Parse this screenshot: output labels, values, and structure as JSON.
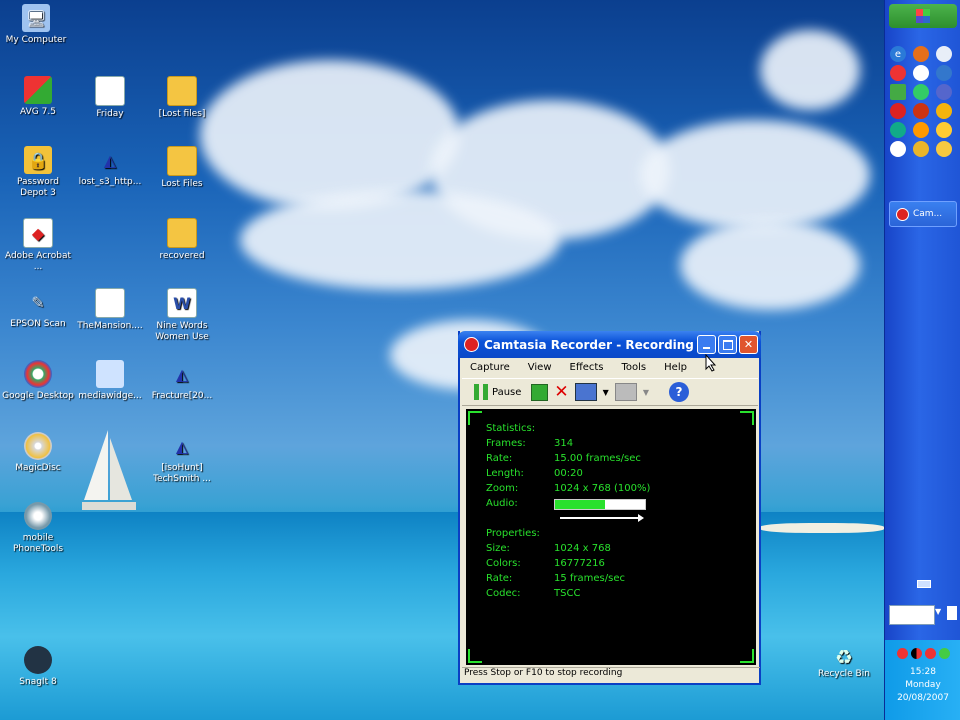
{
  "desktop_icons": [
    {
      "label": "My Computer",
      "glyph": "🖥"
    },
    {
      "label": "AVG 7.5",
      "glyph": "▦"
    },
    {
      "label": "Friday",
      "glyph": "▤"
    },
    {
      "label": "[Lost files]",
      "glyph": ""
    },
    {
      "label": "Password Depot 3",
      "glyph": "🔒"
    },
    {
      "label": "lost_s3_http...",
      "glyph": "◭"
    },
    {
      "label": "Lost Files",
      "glyph": ""
    },
    {
      "label": "Adobe Acrobat ...",
      "glyph": "◆"
    },
    {
      "label": "recovered",
      "glyph": ""
    },
    {
      "label": "EPSON Scan",
      "glyph": "✎"
    },
    {
      "label": "TheMansion....",
      "glyph": "▤"
    },
    {
      "label": "Nine Words Women Use",
      "glyph": "W"
    },
    {
      "label": "Google Desktop",
      "glyph": "◉"
    },
    {
      "label": "mediawidge...",
      "glyph": "▣"
    },
    {
      "label": "Fracture[20...",
      "glyph": "◭"
    },
    {
      "label": "MagicDisc",
      "glyph": "◎"
    },
    {
      "label": "[isoHunt] TechSmith ...",
      "glyph": "◭"
    },
    {
      "label": "mobile PhoneTools",
      "glyph": "◉"
    },
    {
      "label": "SnagIt 8",
      "glyph": "◐"
    },
    {
      "label": "Recycle Bin",
      "glyph": "♻"
    }
  ],
  "recorder": {
    "title": "Camtasia Recorder - Recording",
    "menu": [
      "Capture",
      "View",
      "Effects",
      "Tools",
      "Help"
    ],
    "pause_label": "Pause",
    "help_glyph": "?",
    "status_bar": "Press Stop or F10 to stop recording",
    "statistics_heading": "Statistics:",
    "stats": [
      {
        "k": "Frames:",
        "v": "314"
      },
      {
        "k": "Rate:",
        "v": "15.00 frames/sec"
      },
      {
        "k": "Length:",
        "v": "00:20"
      },
      {
        "k": "Zoom:",
        "v": "1024 x 768 (100%)"
      },
      {
        "k": "Audio:",
        "v": ""
      }
    ],
    "audio_level": 0.55,
    "properties_heading": "Properties:",
    "props": [
      {
        "k": "Size:",
        "v": "1024 x 768"
      },
      {
        "k": "Colors:",
        "v": "16777216"
      },
      {
        "k": "Rate:",
        "v": "15 frames/sec"
      },
      {
        "k": "Codec:",
        "v": "TSCC"
      }
    ]
  },
  "taskbar": {
    "task_label": "Cam...",
    "time": "15:28",
    "day": "Monday",
    "date": "20/08/2007"
  },
  "colors": {
    "lcd_green": "#29e12d",
    "title_blue": "#0a48c8"
  }
}
